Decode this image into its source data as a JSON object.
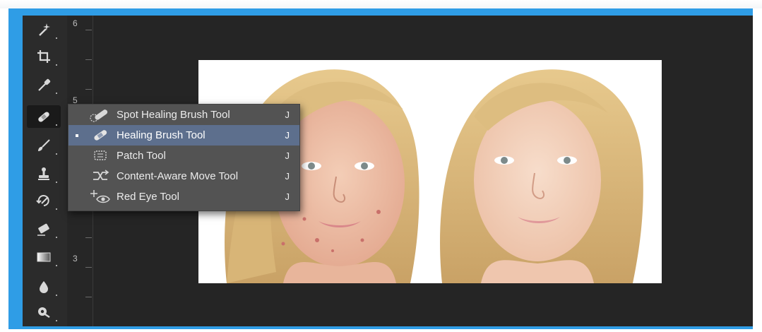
{
  "ruler": {
    "marks": [
      "6",
      "5",
      "3"
    ]
  },
  "toolbar": {
    "tools": [
      {
        "name": "magic-wand"
      },
      {
        "name": "crop"
      },
      {
        "name": "eyedropper"
      },
      {
        "name": "healing-brush",
        "active": true
      },
      {
        "name": "brush"
      },
      {
        "name": "clone-stamp"
      },
      {
        "name": "history-brush"
      },
      {
        "name": "eraser"
      },
      {
        "name": "gradient"
      },
      {
        "name": "blur"
      },
      {
        "name": "dodge"
      }
    ]
  },
  "flyout": {
    "items": [
      {
        "label": "Spot Healing Brush Tool",
        "shortcut": "J",
        "icon": "spot-healing-brush-icon",
        "selected": false
      },
      {
        "label": "Healing Brush Tool",
        "shortcut": "J",
        "icon": "healing-brush-icon",
        "selected": true
      },
      {
        "label": "Patch Tool",
        "shortcut": "J",
        "icon": "patch-icon",
        "selected": false
      },
      {
        "label": "Content-Aware Move Tool",
        "shortcut": "J",
        "icon": "content-aware-move-icon",
        "selected": false
      },
      {
        "label": "Red Eye Tool",
        "shortcut": "J",
        "icon": "red-eye-icon",
        "selected": false
      }
    ]
  },
  "colors": {
    "frame": "#2f9de6",
    "workspace": "#252525",
    "menu_bg": "#535353",
    "menu_selected": "#5d6f8d"
  }
}
